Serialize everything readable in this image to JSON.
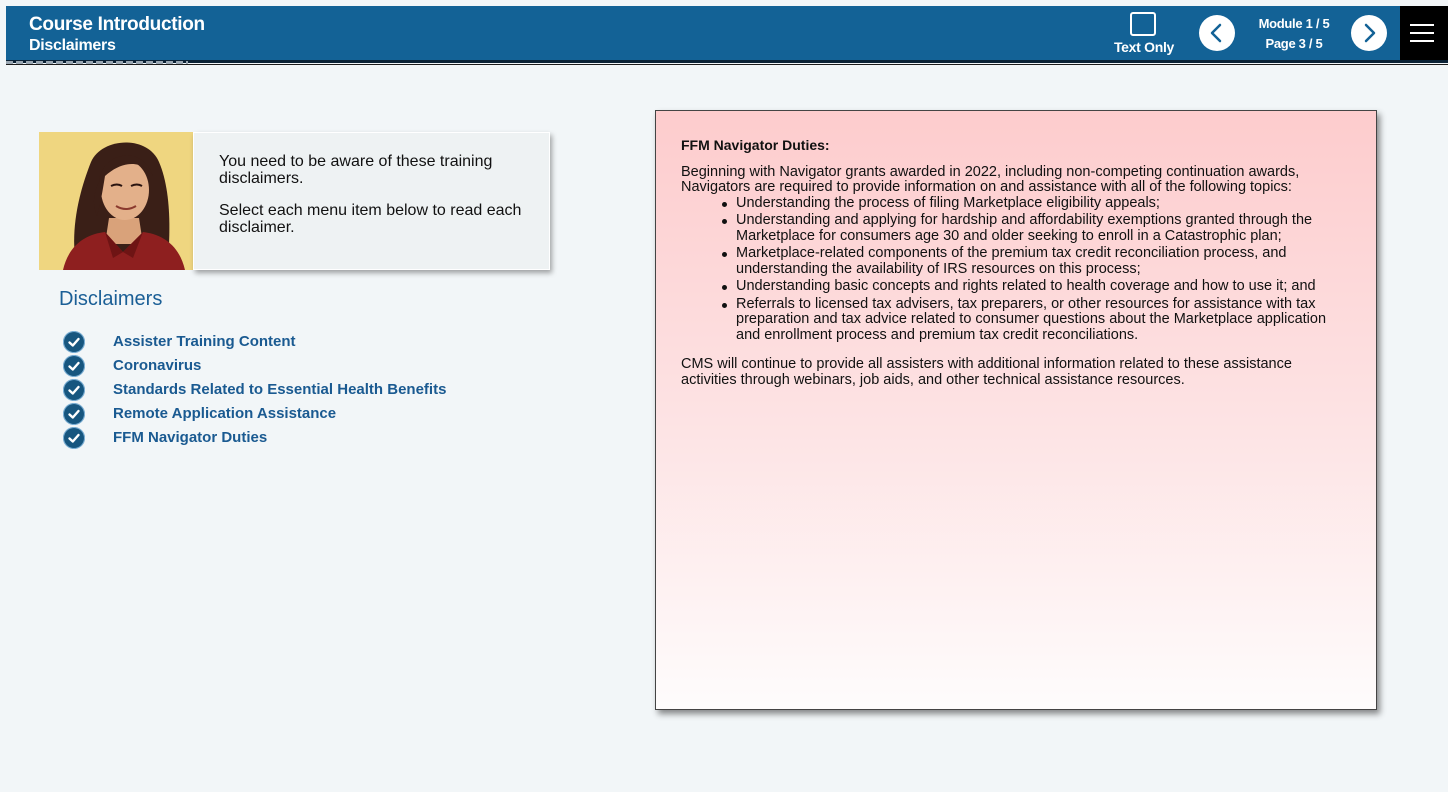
{
  "header": {
    "title": "Course Introduction",
    "subtitle": "Disclaimers",
    "text_only_label": "Text Only",
    "module": "Module 1 / 5",
    "page": "Page 3 / 5",
    "accent_color": "#136296"
  },
  "intro": {
    "line1": "You need to be aware of these training disclaimers.",
    "line2": "Select each menu item below to read each disclaimer."
  },
  "disclaimers": {
    "heading": "Disclaimers",
    "items": [
      {
        "label": "Assister Training Content",
        "completed": true
      },
      {
        "label": "Coronavirus",
        "completed": true
      },
      {
        "label": "Standards Related to Essential Health Benefits",
        "completed": true
      },
      {
        "label": "Remote Application Assistance",
        "completed": true
      },
      {
        "label": "FFM Navigator Duties",
        "completed": true
      }
    ]
  },
  "content": {
    "title": "FFM Navigator Duties:",
    "intro": "Beginning with Navigator grants awarded in 2022, including non-competing continuation awards, Navigators are required to provide information on and assistance with all of the following topics:",
    "bullets": [
      "Understanding the process of filing Marketplace eligibility appeals;",
      "Understanding and applying for hardship and affordability exemptions granted through the Marketplace for consumers age 30 and older seeking to enroll in a Catastrophic plan;",
      "Marketplace-related components of the premium tax credit reconciliation process, and understanding the availability of IRS resources on this process;",
      "Understanding basic concepts and rights related to health coverage and how to use it; and",
      "Referrals to licensed tax advisers, tax preparers, or other resources for assistance with tax preparation and tax advice related to consumer questions about the Marketplace application and enrollment process and premium tax credit reconciliations."
    ],
    "outro": "CMS will continue to provide all assisters with additional information related to these assistance activities through webinars, job aids, and other technical assistance resources."
  }
}
